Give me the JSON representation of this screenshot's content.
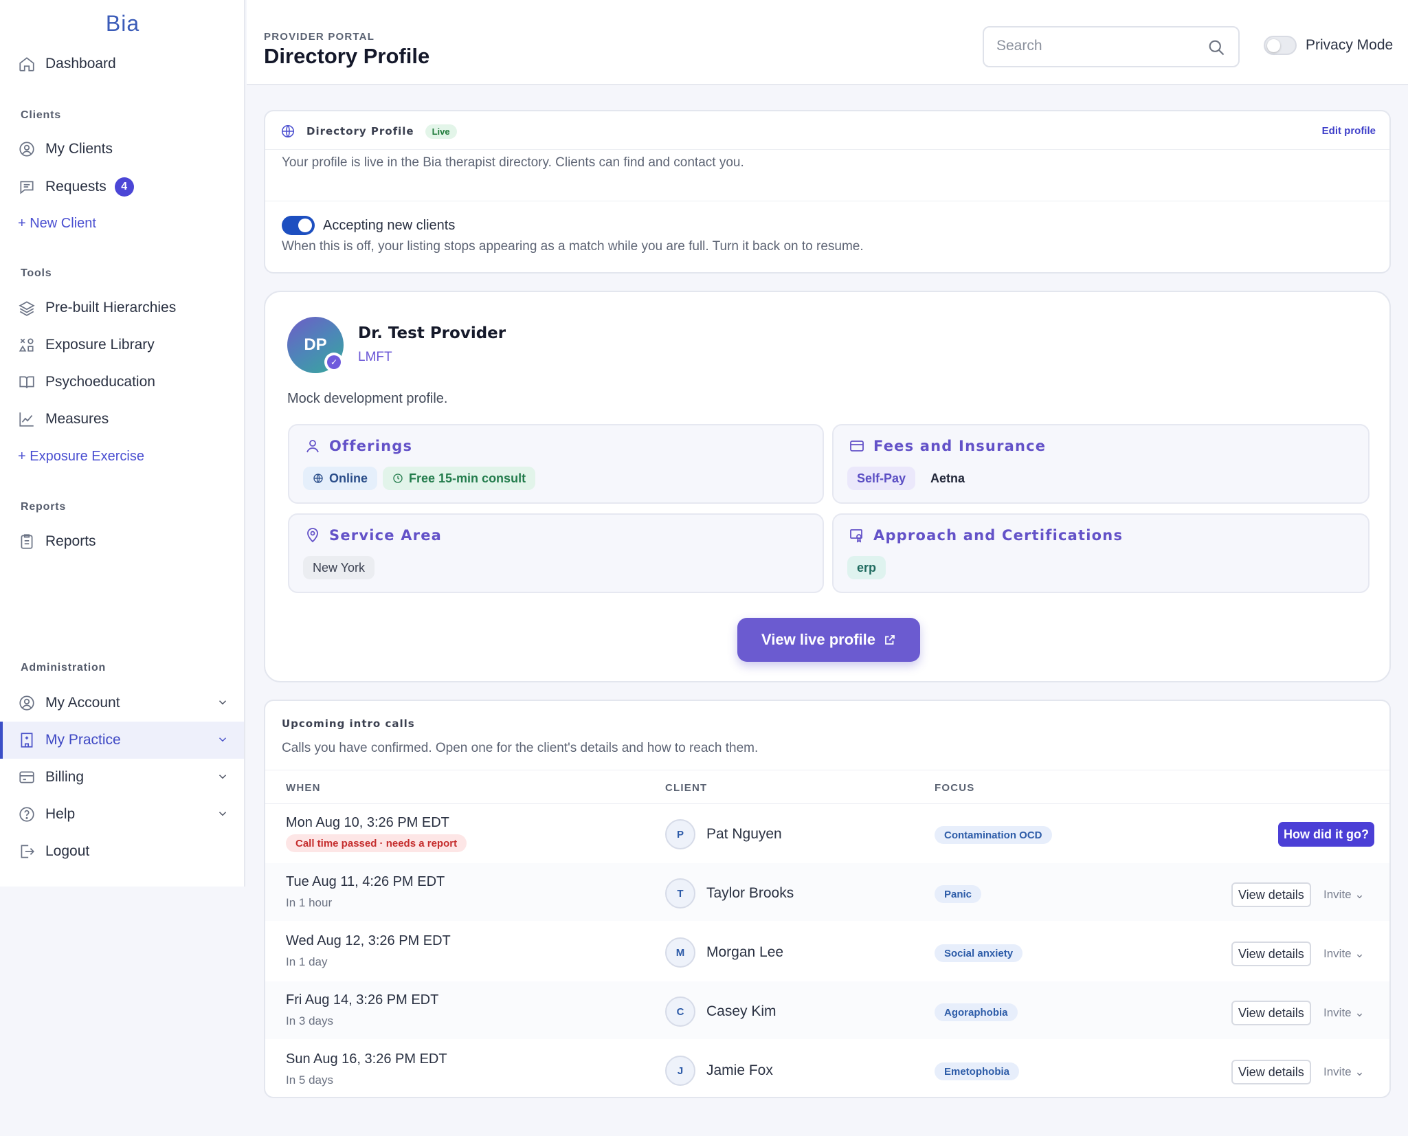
{
  "brand": "Bia",
  "sidebar": {
    "dashboard": "Dashboard",
    "sections": {
      "clients": "Clients",
      "tools": "Tools",
      "reports": "Reports",
      "administration": "Administration"
    },
    "my_clients": "My Clients",
    "requests": "Requests",
    "requests_count": "4",
    "new_client": "+ New Client",
    "prebuilt": "Pre-built Hierarchies",
    "exposure_library": "Exposure Library",
    "psychoeducation": "Psychoeducation",
    "measures": "Measures",
    "exposure_exercise": "+ Exposure Exercise",
    "reports_item": "Reports",
    "my_account": "My Account",
    "my_practice": "My Practice",
    "billing": "Billing",
    "help": "Help",
    "logout": "Logout"
  },
  "header": {
    "eyebrow": "PROVIDER PORTAL",
    "title": "Directory Profile",
    "search_placeholder": "Search",
    "privacy_label": "Privacy Mode",
    "privacy_on": false
  },
  "directory": {
    "title": "Directory Profile",
    "status": "Live",
    "edit": "Edit profile",
    "desc": "Your profile is live in the Bia therapist directory. Clients can find and contact you.",
    "accepting_label": "Accepting new clients",
    "accepting_on": true,
    "accepting_note": "When this is off, your listing stops appearing as a match while you are full. Turn it back on to resume."
  },
  "profile": {
    "initials": "DP",
    "name": "Dr. Test Provider",
    "credential": "LMFT",
    "bio": "Mock development profile.",
    "offerings_title": "Offerings",
    "offerings": [
      "Online",
      "Free 15-min consult"
    ],
    "fees_title": "Fees and Insurance",
    "fees": [
      "Self-Pay",
      "Aetna"
    ],
    "service_title": "Service Area",
    "service": [
      "New York"
    ],
    "approach_title": "Approach and Certifications",
    "approach": [
      "erp"
    ],
    "view_live": "View live profile"
  },
  "calls": {
    "title": "Upcoming intro calls",
    "desc": "Calls you have confirmed. Open one for the client's details and how to reach them.",
    "headers": {
      "when": "WHEN",
      "client": "CLIENT",
      "focus": "FOCUS"
    },
    "rows": [
      {
        "when": "Mon Aug 10, 3:26 PM EDT",
        "sub": "Call time passed · needs a report",
        "initial": "P",
        "client": "Pat Nguyen",
        "focus": "Contamination OCD",
        "action": "How did it go?"
      },
      {
        "when": "Tue Aug 11, 4:26 PM EDT",
        "sub": "In 1 hour",
        "initial": "T",
        "client": "Taylor Brooks",
        "focus": "Panic",
        "action": "View details",
        "invite": "Invite ⌄"
      },
      {
        "when": "Wed Aug 12, 3:26 PM EDT",
        "sub": "In 1 day",
        "initial": "M",
        "client": "Morgan Lee",
        "focus": "Social anxiety",
        "action": "View details",
        "invite": "Invite ⌄"
      },
      {
        "when": "Fri Aug 14, 3:26 PM EDT",
        "sub": "In 3 days",
        "initial": "C",
        "client": "Casey Kim",
        "focus": "Agoraphobia",
        "action": "View details",
        "invite": "Invite ⌄"
      },
      {
        "when": "Sun Aug 16, 3:26 PM EDT",
        "sub": "In 5 days",
        "initial": "J",
        "client": "Jamie Fox",
        "focus": "Emetophobia",
        "action": "View details",
        "invite": "Invite ⌄"
      }
    ]
  },
  "colors": {
    "accent": "#4b46d6",
    "brand": "#3a5bb8",
    "primary_button": "#6b5bd0",
    "toggle_on": "#1d4fc0"
  }
}
